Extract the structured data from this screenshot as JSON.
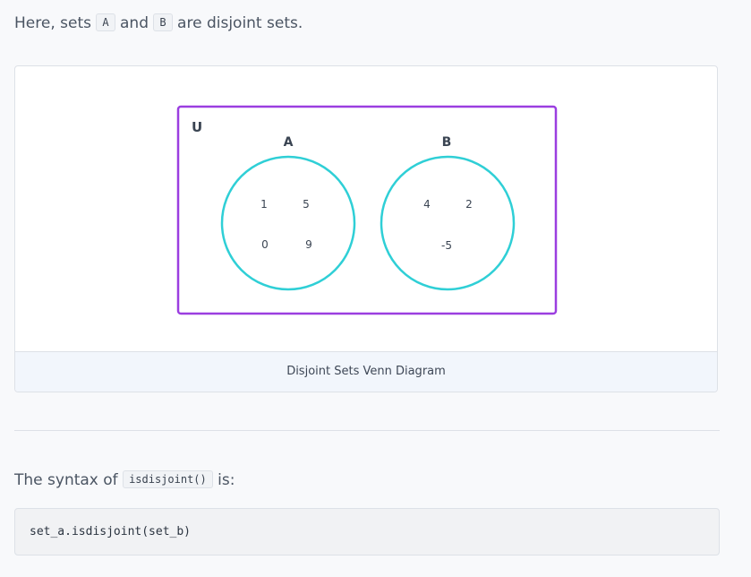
{
  "intro": {
    "prefix": "Here, sets",
    "set_a": "A",
    "middle": "and",
    "set_b": "B",
    "suffix": "are disjoint sets."
  },
  "diagram": {
    "universe_label": "U",
    "set_a": {
      "label": "A",
      "elements": [
        "1",
        "5",
        "0",
        "9"
      ]
    },
    "set_b": {
      "label": "B",
      "elements": [
        "4",
        "2",
        "-5"
      ]
    },
    "caption": "Disjoint Sets Venn Diagram",
    "colors": {
      "universe_border": "#9b3ee0",
      "circle": "#2fcfd6"
    }
  },
  "syntax": {
    "prefix": "The syntax of",
    "method": "isdisjoint()",
    "suffix": "is:",
    "code": "set_a.isdisjoint(set_b)"
  }
}
